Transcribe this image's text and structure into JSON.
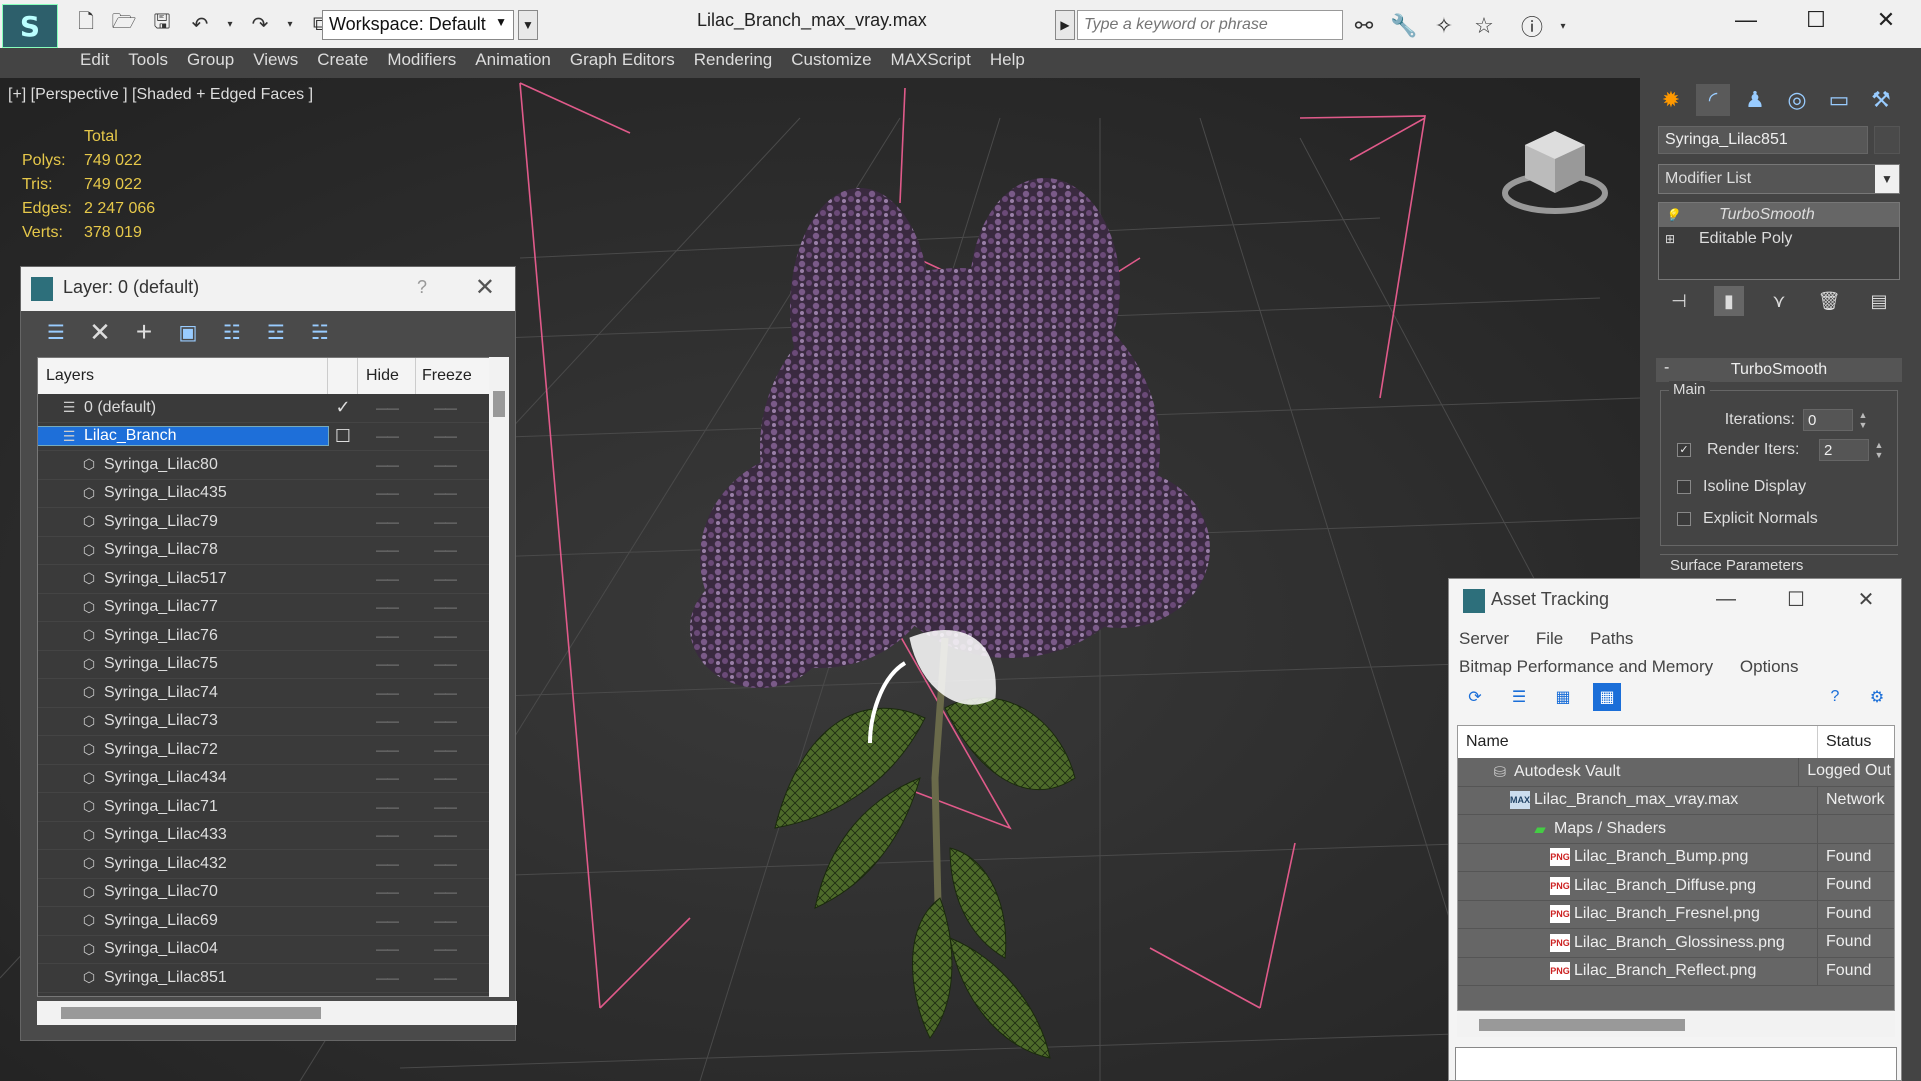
{
  "window": {
    "title": "Lilac_Branch_max_vray.max",
    "workspace_label": "Workspace: Default",
    "search_placeholder": "Type a keyword or phrase",
    "minimize": "—",
    "maximize": "☐",
    "close": "✕"
  },
  "menu": [
    "Edit",
    "Tools",
    "Group",
    "Views",
    "Create",
    "Modifiers",
    "Animation",
    "Graph Editors",
    "Rendering",
    "Customize",
    "MAXScript",
    "Help"
  ],
  "viewport": {
    "label": "[+] [Perspective ] [Shaded + Edged Faces ]",
    "stats": {
      "header": "Total",
      "rows": [
        {
          "key": "Polys:",
          "value": "749 022"
        },
        {
          "key": "Tris:",
          "value": "749 022"
        },
        {
          "key": "Edges:",
          "value": "2 247 066"
        },
        {
          "key": "Verts:",
          "value": "378 019"
        }
      ]
    }
  },
  "layer_panel": {
    "title": "Layer: 0 (default)",
    "help": "?",
    "close": "✕",
    "columns": {
      "layers": "Layers",
      "hide": "Hide",
      "freeze": "Freeze"
    },
    "rows": [
      {
        "name": "0 (default)",
        "type": "layer",
        "indent": 1,
        "check": "✓",
        "selected": false
      },
      {
        "name": "Lilac_Branch",
        "type": "layer",
        "indent": 1,
        "check": "☐",
        "selected": true
      },
      {
        "name": "Syringa_Lilac80",
        "type": "obj",
        "indent": 2
      },
      {
        "name": "Syringa_Lilac435",
        "type": "obj",
        "indent": 2
      },
      {
        "name": "Syringa_Lilac79",
        "type": "obj",
        "indent": 2
      },
      {
        "name": "Syringa_Lilac78",
        "type": "obj",
        "indent": 2
      },
      {
        "name": "Syringa_Lilac517",
        "type": "obj",
        "indent": 2
      },
      {
        "name": "Syringa_Lilac77",
        "type": "obj",
        "indent": 2
      },
      {
        "name": "Syringa_Lilac76",
        "type": "obj",
        "indent": 2
      },
      {
        "name": "Syringa_Lilac75",
        "type": "obj",
        "indent": 2
      },
      {
        "name": "Syringa_Lilac74",
        "type": "obj",
        "indent": 2
      },
      {
        "name": "Syringa_Lilac73",
        "type": "obj",
        "indent": 2
      },
      {
        "name": "Syringa_Lilac72",
        "type": "obj",
        "indent": 2
      },
      {
        "name": "Syringa_Lilac434",
        "type": "obj",
        "indent": 2
      },
      {
        "name": "Syringa_Lilac71",
        "type": "obj",
        "indent": 2
      },
      {
        "name": "Syringa_Lilac433",
        "type": "obj",
        "indent": 2
      },
      {
        "name": "Syringa_Lilac432",
        "type": "obj",
        "indent": 2
      },
      {
        "name": "Syringa_Lilac70",
        "type": "obj",
        "indent": 2
      },
      {
        "name": "Syringa_Lilac69",
        "type": "obj",
        "indent": 2
      },
      {
        "name": "Syringa_Lilac04",
        "type": "obj",
        "indent": 2
      },
      {
        "name": "Syringa_Lilac851",
        "type": "obj",
        "indent": 2
      }
    ]
  },
  "command_panel": {
    "object_name": "Syringa_Lilac851",
    "modifier_list": "Modifier List",
    "stack": [
      "TurboSmooth",
      "Editable Poly"
    ],
    "rollout_title": "TurboSmooth",
    "group_main": "Main",
    "iterations_label": "Iterations:",
    "iterations_value": "0",
    "render_iters_label": "Render Iters:",
    "render_iters_value": "2",
    "isoline_label": "Isoline Display",
    "explicit_normals_label": "Explicit Normals",
    "surface_params_label": "Surface Parameters"
  },
  "asset_tracking": {
    "title": "Asset Tracking",
    "menu_row1": [
      "Server",
      "File",
      "Paths"
    ],
    "menu_row2": [
      "Bitmap Performance and Memory",
      "Options"
    ],
    "columns": {
      "name": "Name",
      "status": "Status"
    },
    "rows": [
      {
        "name": "Autodesk Vault",
        "icon": "vault",
        "indent": 1,
        "status": "Logged Out"
      },
      {
        "name": "Lilac_Branch_max_vray.max",
        "icon": "max",
        "indent": 2,
        "status": "Network"
      },
      {
        "name": "Maps / Shaders",
        "icon": "maps",
        "indent": 3,
        "status": ""
      },
      {
        "name": "Lilac_Branch_Bump.png",
        "icon": "png",
        "indent": 4,
        "status": "Found"
      },
      {
        "name": "Lilac_Branch_Diffuse.png",
        "icon": "png",
        "indent": 4,
        "status": "Found"
      },
      {
        "name": "Lilac_Branch_Fresnel.png",
        "icon": "png",
        "indent": 4,
        "status": "Found"
      },
      {
        "name": "Lilac_Branch_Glossiness.png",
        "icon": "png",
        "indent": 4,
        "status": "Found"
      },
      {
        "name": "Lilac_Branch_Reflect.png",
        "icon": "png",
        "indent": 4,
        "status": "Found"
      }
    ]
  }
}
